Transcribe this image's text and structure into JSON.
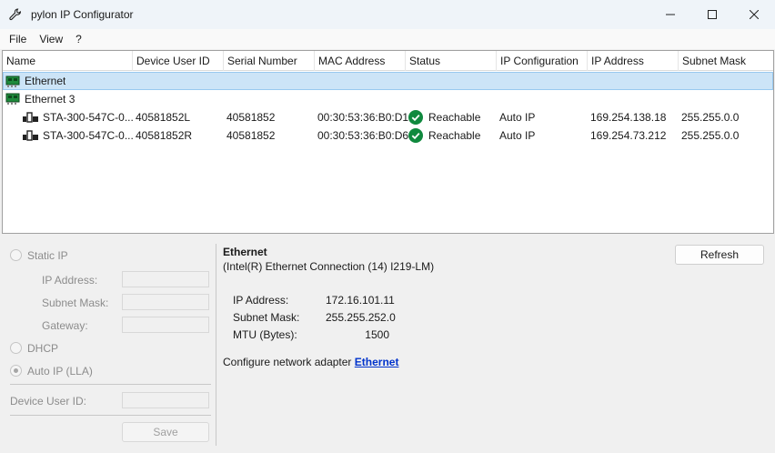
{
  "window": {
    "title": "pylon IP Configurator"
  },
  "menu": [
    "File",
    "View",
    "?"
  ],
  "columns": [
    "Name",
    "Device User ID",
    "Serial Number",
    "MAC Address",
    "Status",
    "IP Configuration",
    "IP Address",
    "Subnet Mask"
  ],
  "adapters": [
    {
      "name": "Ethernet",
      "selected": true
    },
    {
      "name": "Ethernet 3",
      "selected": false
    }
  ],
  "devices": [
    {
      "name": "STA-300-547C-0...",
      "user_id": "40581852L",
      "serial": "40581852",
      "mac": "00:30:53:36:B0:D1",
      "status": "Reachable",
      "ip_config": "Auto IP",
      "ip": "169.254.138.18",
      "subnet": "255.255.0.0"
    },
    {
      "name": "STA-300-547C-0...",
      "user_id": "40581852R",
      "serial": "40581852",
      "mac": "00:30:53:36:B0:D6",
      "status": "Reachable",
      "ip_config": "Auto IP",
      "ip": "169.254.73.212",
      "subnet": "255.255.0.0"
    }
  ],
  "config": {
    "static_ip": "Static IP",
    "ip_address": "IP Address:",
    "subnet_mask": "Subnet Mask:",
    "gateway": "Gateway:",
    "dhcp": "DHCP",
    "auto_ip": "Auto IP (LLA)",
    "device_user_id": "Device User ID:",
    "save": "Save"
  },
  "adapter_info": {
    "name": "Ethernet",
    "description": "(Intel(R) Ethernet Connection (14) I219-LM)",
    "ip_label": "IP Address:",
    "ip_value": "172.16.101.11",
    "subnet_label": "Subnet Mask:",
    "subnet_value": "255.255.252.0",
    "mtu_label": "MTU (Bytes):",
    "mtu_value": "1500",
    "configure_text": "Configure network adapter",
    "configure_link": "Ethernet",
    "refresh": "Refresh"
  },
  "colors": {
    "selection": "#cce4f7",
    "status_ok": "#10893e",
    "link": "#0033cc",
    "nic_green": "#1e8a3c"
  }
}
